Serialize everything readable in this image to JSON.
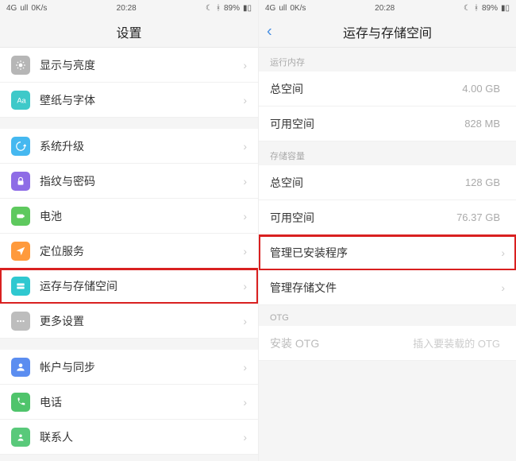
{
  "status": {
    "network": "4G",
    "signal_extra": "ull",
    "speed": "0K/s",
    "time": "20:28",
    "moon": "☾",
    "bt_icon": "ᚼ",
    "battery": "89%"
  },
  "left": {
    "title": "设置",
    "items": [
      {
        "icon": "sun",
        "color": "ic-gray",
        "label": "显示与亮度"
      },
      {
        "icon": "font",
        "color": "ic-teal",
        "label": "壁纸与字体"
      },
      {
        "icon": "update",
        "color": "ic-skyblue",
        "label": "系统升级",
        "gap": true
      },
      {
        "icon": "lock",
        "color": "ic-purple",
        "label": "指纹与密码"
      },
      {
        "icon": "battery",
        "color": "ic-green",
        "label": "电池"
      },
      {
        "icon": "location",
        "color": "ic-orange",
        "label": "定位服务"
      },
      {
        "icon": "storage",
        "color": "ic-cyan",
        "label": "运存与存储空间",
        "highlight": true
      },
      {
        "icon": "more",
        "color": "ic-gray2",
        "label": "更多设置"
      },
      {
        "icon": "account",
        "color": "ic-blue",
        "label": "帐户与同步",
        "gap": true
      },
      {
        "icon": "phone",
        "color": "ic-green2",
        "label": "电话"
      },
      {
        "icon": "contacts",
        "color": "ic-green3",
        "label": "联系人"
      }
    ]
  },
  "right": {
    "title": "运存与存储空间",
    "sections": [
      {
        "header": "运行内存",
        "rows": [
          {
            "label": "总空间",
            "value": "4.00 GB"
          },
          {
            "label": "可用空间",
            "value": "828 MB"
          }
        ]
      },
      {
        "header": "存储容量",
        "rows": [
          {
            "label": "总空间",
            "value": "128 GB"
          },
          {
            "label": "可用空间",
            "value": "76.37 GB"
          },
          {
            "label": "管理已安装程序",
            "value": "",
            "highlight": true,
            "chev": true
          },
          {
            "label": "管理存储文件",
            "value": "",
            "chev": true
          }
        ]
      },
      {
        "header": "OTG",
        "rows": [
          {
            "label": "安装 OTG",
            "value": "插入要装载的 OTG",
            "faded": true
          }
        ]
      }
    ]
  }
}
